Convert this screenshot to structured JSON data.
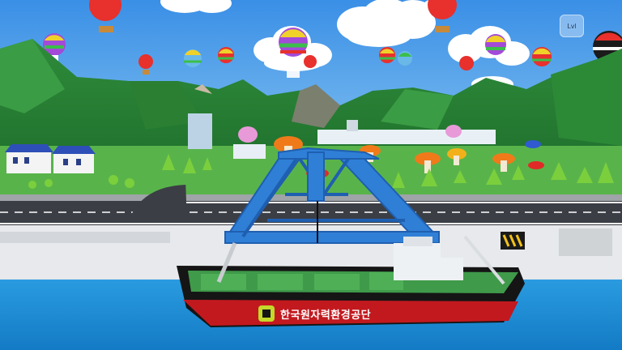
{
  "hud": {
    "menu_button_label": "Lvl"
  },
  "ship": {
    "company_name": "한국원자력환경공단",
    "logo_icon": "korad-logo-icon",
    "hull_color": "#161616",
    "stripe_color": "#c2191f",
    "deck_color": "#3f9a4a"
  },
  "colors": {
    "sky": "#4c9fe8",
    "water": "#1f8fd8",
    "crane": "#2f7fd6",
    "grass": "#46a93b"
  }
}
